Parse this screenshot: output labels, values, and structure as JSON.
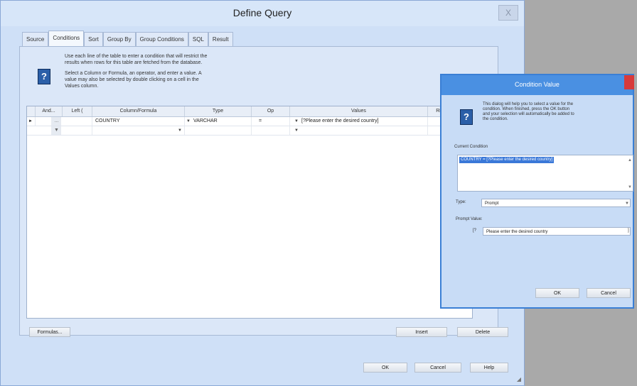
{
  "window": {
    "title": "Define Query",
    "close_label": "X"
  },
  "tabs": [
    "Source",
    "Conditions",
    "Sort",
    "Group By",
    "Group Conditions",
    "SQL",
    "Result"
  ],
  "instructions": {
    "line1": "Use each line of the table to enter a condition that will restrict the",
    "line2": "results when rows for this table are fetched from the database.",
    "line3": "Select a Column or Formula, an operator, and enter a value. A",
    "line4": "value may also be selected by double clicking on a cell in the",
    "line5": "Values column."
  },
  "grid": {
    "columns": [
      "And...",
      "Left (",
      "Column/Formula",
      "Type",
      "Op",
      "Values",
      "Ri"
    ],
    "rows": [
      {
        "andor": "...",
        "left": "",
        "column": "COUNTRY",
        "type": "VARCHAR",
        "op": "=",
        "value": "[?Please enter the desired country]"
      },
      {
        "andor": "",
        "left": "",
        "column": "",
        "type": "",
        "op": "",
        "value": ""
      }
    ]
  },
  "buttons": {
    "formulas": "Formulas...",
    "insert": "Insert",
    "delete": "Delete",
    "ok": "OK",
    "cancel": "Cancel",
    "help": "Help"
  },
  "dialog": {
    "title": "Condition Value",
    "description_line1": "This dialog will help you to select a value for the",
    "description_line2": "condition. When finished, press the OK button",
    "description_line3": "and your selection will automatically be added to",
    "description_line4": "the condition.",
    "current_condition_label": "Current Condition",
    "current_condition_value": "COUNTRY = [?Please enter the desired country]",
    "type_label": "Type:",
    "type_value": "Prompt",
    "prompt_value_label": "Prompt Value:",
    "prompt_prefix": "[?",
    "prompt_text": "Please enter the desired country",
    "prompt_suffix": "]",
    "ok": "OK",
    "cancel": "Cancel"
  }
}
